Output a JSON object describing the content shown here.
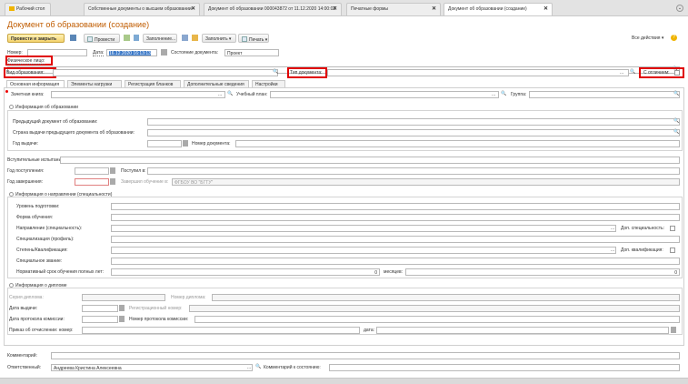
{
  "tabs": [
    {
      "label": "Рабочий стол"
    },
    {
      "label": "Собственные документы о высшем образовании"
    },
    {
      "label": "Документ об образовании 000043872 от 11.12.2020 14:00:02"
    },
    {
      "label": "Печатные формы"
    },
    {
      "label": "Документ об образовании (создание)"
    }
  ],
  "title": "Документ об образовании (создание)",
  "toolbar": {
    "post_close": "Провести и закрыть",
    "post": "Провести",
    "fill": "Заполнение...",
    "fill_menu": "Заполнить",
    "print": "Печать",
    "all_actions": "Все действия"
  },
  "header": {
    "number_label": "Номер:",
    "number_value": "",
    "date_label": "Дата:",
    "date_value": "16.12.2020 16:13:13",
    "state_label": "Состояние документа:",
    "state_value": "Проект"
  },
  "person": {
    "label": "Физическое лицо:",
    "value": ""
  },
  "doc_kind": {
    "label": "Вид образования:",
    "value": "",
    "type_label": "Тип документа:",
    "type_value": "",
    "honors_label": "С отличием:"
  },
  "inner_tabs": [
    {
      "label": "Основная информация"
    },
    {
      "label": "Элементы нагрузки"
    },
    {
      "label": "Регистрация бланков"
    },
    {
      "label": "Дополнительные сведения"
    },
    {
      "label": "Настройки"
    }
  ],
  "main": {
    "record_book_label": "Зачетная книга:",
    "study_plan_label": "Учебный план:",
    "group_label": "Группа:",
    "edu_info_title": "Информация об образовании",
    "prev_doc_label": "Предыдущий документ об образовании:",
    "prev_country_label": "Страна выдачи предыдущего документа об образовании:",
    "year_issue_label": "Год выдачи:",
    "doc_number_label": "Номер документа:",
    "entrance_label": "Вступительные испытания:",
    "year_enter_label": "Год поступления:",
    "entered_to_label": "Поступил в:",
    "year_finish_label": "Год завершения:",
    "finished_in_label": "Завершил обучение в:",
    "finished_in_value": "ФГБОУ ВО \"БГТУ\"",
    "direction_title": "Информация о направлении (специальности)",
    "level_label": "Уровень подготовки:",
    "form_label": "Форма обучения:",
    "direction_label": "Направление (специальность):",
    "extra_spec_label": "Доп. специальность:",
    "specialization_label": "Специализация (профиль):",
    "degree_label": "Степень/Квалификация:",
    "extra_qual_label": "Доп. квалификация:",
    "special_title_label": "Специальное звание:",
    "norm_term_label": "Нормативный срок обучения полных лет:",
    "norm_years_value": "0",
    "months_label": "месяцев:",
    "months_value": "0",
    "diploma_title": "Информация о дипломе",
    "diploma_series_label": "Серия диплома:",
    "diploma_number_label": "Номер диплома:",
    "issue_date_label": "Дата выдачи:",
    "reg_number_label": "Регистрационный номер:",
    "protocol_date_label": "Дата протокола комиссии:",
    "protocol_number_label": "Номер протокола комиссии:",
    "expel_order_label": "Приказ об отчислении: номер:",
    "expel_date_label": "дата:"
  },
  "footer": {
    "comment_label": "Комментарий:",
    "responsible_label": "Ответственный:",
    "responsible_value": "Андреева Кристина Алексеевна",
    "state_comment_label": "Комментарий к состоянию:"
  },
  "colors": {
    "title": "#c05c00",
    "highlight": "#e00000",
    "primary_btn": "#f4d36d"
  }
}
